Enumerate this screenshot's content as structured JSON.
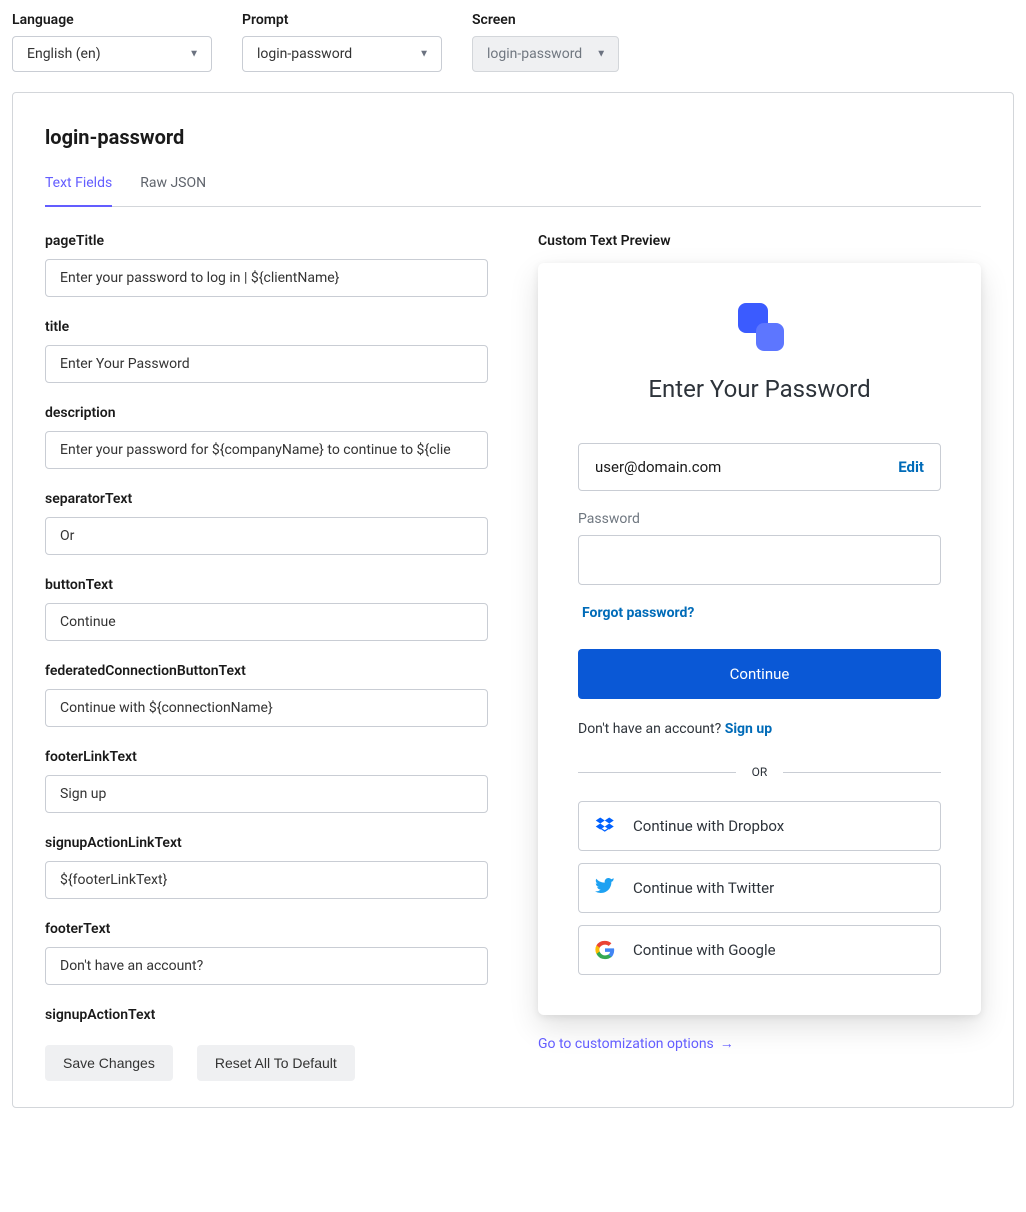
{
  "topSelects": {
    "language": {
      "label": "Language",
      "value": "English (en)"
    },
    "prompt": {
      "label": "Prompt",
      "value": "login-password"
    },
    "screen": {
      "label": "Screen",
      "value": "login-password"
    }
  },
  "panelTitle": "login-password",
  "tabs": {
    "textFields": "Text Fields",
    "rawJson": "Raw JSON"
  },
  "fields": [
    {
      "label": "pageTitle",
      "value": "Enter your password to log in | ${clientName}"
    },
    {
      "label": "title",
      "value": "Enter Your Password"
    },
    {
      "label": "description",
      "value": "Enter your password for ${companyName} to continue to ${clie"
    },
    {
      "label": "separatorText",
      "value": "Or"
    },
    {
      "label": "buttonText",
      "value": "Continue"
    },
    {
      "label": "federatedConnectionButtonText",
      "value": "Continue with ${connectionName}"
    },
    {
      "label": "footerLinkText",
      "value": "Sign up"
    },
    {
      "label": "signupActionLinkText",
      "value": "${footerLinkText}"
    },
    {
      "label": "footerText",
      "value": "Don't have an account?"
    },
    {
      "label": "signupActionText",
      "value": ""
    }
  ],
  "preview": {
    "heading": "Custom Text Preview",
    "title": "Enter Your Password",
    "email": "user@domain.com",
    "editLabel": "Edit",
    "passwordLabel": "Password",
    "forgot": "Forgot password?",
    "continue": "Continue",
    "footerText": "Don't have an account? ",
    "signup": "Sign up",
    "separator": "OR",
    "social": [
      {
        "name": "dropbox",
        "label": "Continue with Dropbox"
      },
      {
        "name": "twitter",
        "label": "Continue with Twitter"
      },
      {
        "name": "google",
        "label": "Continue with Google"
      }
    ],
    "customizationLink": "Go to customization options"
  },
  "actions": {
    "save": "Save Changes",
    "reset": "Reset All To Default"
  }
}
